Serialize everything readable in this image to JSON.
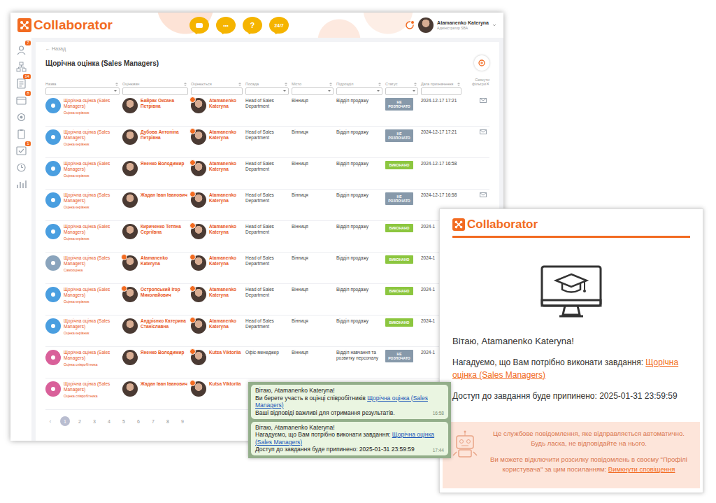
{
  "app": {
    "logo": "Collaborator",
    "header": {
      "bubbles": [
        "•••",
        "?",
        "24/7"
      ],
      "user": {
        "name": "Atamanenko Kateryna",
        "role": "Адміністратор SBA"
      }
    },
    "sidebar": {
      "items": [
        {
          "badge": "7"
        },
        {
          "badge": null
        },
        {
          "badge": "14"
        },
        {
          "badge": "8"
        },
        {
          "badge": null
        },
        {
          "badge": null
        },
        {
          "badge": "1"
        },
        {
          "badge": null
        },
        {
          "badge": null
        }
      ]
    },
    "back": "← Назад",
    "title": "Щорічна оцінка (Sales Managers)",
    "table": {
      "columns": [
        {
          "label": "Назва",
          "filter": "select"
        },
        {
          "label": "Оцінювач",
          "filter": "input"
        },
        {
          "label": "Оцінюється",
          "filter": "input"
        },
        {
          "label": "Посада",
          "filter": "select"
        },
        {
          "label": "Місто",
          "filter": "select"
        },
        {
          "label": "Підрозділ",
          "filter": "select"
        },
        {
          "label": "Статус",
          "filter": "select"
        },
        {
          "label": "Дата призначення",
          "filter": "input"
        }
      ],
      "reset": "Скинути фільтри",
      "reset_icon": "✕",
      "rows": [
        {
          "name": "Щорічна оцінка (Sales Managers)",
          "subtitle": "Оцінка керівник",
          "icon_color": "#4a9fe0",
          "evaluator": "Байрак Оксана Петрівна",
          "evaluator_marked": false,
          "evaluated": "Atamanenko Kateryna",
          "position": "Head of Sales Department",
          "city": "Вінниця",
          "department": "Відділ продажу",
          "status": {
            "label": "НЕ РОЗПОЧАТО",
            "color": "#8799aa"
          },
          "date": "2024-12-17 17:21",
          "reminder": true
        },
        {
          "name": "Щорічна оцінка (Sales Managers)",
          "subtitle": "Оцінка керівник",
          "icon_color": "#4a9fe0",
          "evaluator": "Дубова Антоніна Петрівна",
          "evaluator_marked": false,
          "evaluated": "Atamanenko Kateryna",
          "position": "Head of Sales Department",
          "city": "Вінниця",
          "department": "Відділ продажу",
          "status": {
            "label": "НЕ РОЗПОЧАТО",
            "color": "#8799aa"
          },
          "date": "2024-12-17 17:21",
          "reminder": true
        },
        {
          "name": "Щорічна оцінка (Sales Managers)",
          "subtitle": "Оцінка керівник",
          "icon_color": "#4a9fe0",
          "evaluator": "Яненко Володимир",
          "evaluator_marked": false,
          "evaluated": "Atamanenko Kateryna",
          "position": "Head of Sales Department",
          "city": "Вінниця",
          "department": "Відділ продажу",
          "status": {
            "label": "ВИКОНАНО",
            "color": "#8cc63f"
          },
          "date": "2024-12-17 16:58",
          "reminder": false
        },
        {
          "name": "Щорічна оцінка (Sales Managers)",
          "subtitle": "Оцінка керівник",
          "icon_color": "#4a9fe0",
          "evaluator": "Жадан Іван Іванович",
          "evaluator_marked": false,
          "evaluated": "Atamanenko Kateryna",
          "position": "Head of Sales Department",
          "city": "Вінниця",
          "department": "Відділ продажу",
          "status": {
            "label": "НЕ РОЗПОЧАТО",
            "color": "#8799aa"
          },
          "date": "2024-12-17 16:58",
          "reminder": true
        },
        {
          "name": "Щорічна оцінка (Sales Managers)",
          "subtitle": "Оцінка керівник",
          "icon_color": "#4a9fe0",
          "evaluator": "Кириченко Тетяна Сергіївна",
          "evaluator_marked": false,
          "evaluated": "Atamanenko Kateryna",
          "position": "Head of Sales Department",
          "city": "Вінниця",
          "department": "Відділ продажу",
          "status": {
            "label": "ВИКОНАНО",
            "color": "#8cc63f"
          },
          "date": "2024-1",
          "reminder": false
        },
        {
          "name": "Щорічна оцінка (Sales Managers)",
          "subtitle": "Самооцінка",
          "icon_color": "#8aa4bd",
          "evaluator": "Atamanenko Kateryna",
          "evaluator_marked": true,
          "evaluated": "Atamanenko Kateryna",
          "position": "Head of Sales Department",
          "city": "Вінниця",
          "department": "Відділ продажу",
          "status": {
            "label": "ВИКОНАНО",
            "color": "#8cc63f"
          },
          "date": "2024-1",
          "reminder": false
        },
        {
          "name": "Щорічна оцінка (Sales Managers)",
          "subtitle": "Оцінка керівник",
          "icon_color": "#4a9fe0",
          "evaluator": "Остропський Ігор Миколайович",
          "evaluator_marked": true,
          "evaluated": "Atamanenko Kateryna",
          "position": "Head of Sales Department",
          "city": "Вінниця",
          "department": "Відділ продажу",
          "status": {
            "label": "ВИКОНАНО",
            "color": "#8cc63f"
          },
          "date": "2024-1",
          "reminder": false
        },
        {
          "name": "Щорічна оцінка (Sales Managers)",
          "subtitle": "Оцінка керівник",
          "icon_color": "#4a9fe0",
          "evaluator": "Андрієнко Катерина Станіславна",
          "evaluator_marked": false,
          "evaluated": "Atamanenko Kateryna",
          "position": "Head of Sales Department",
          "city": "Вінниця",
          "department": "Відділ продажу",
          "status": {
            "label": "ВИКОНАНО",
            "color": "#8cc63f"
          },
          "date": "2024-1",
          "reminder": false
        },
        {
          "name": "Щорічна оцінка (Sales Managers)",
          "subtitle": "Оцінка співробітника",
          "icon_color": "#d9609a",
          "evaluator": "Яненко Володимир",
          "evaluator_marked": false,
          "evaluated": "Kutsa Viktoriia",
          "position": "Офіс-менеджер",
          "city": "Вінниця",
          "department": "Відділ навчання та розвитку персоналу",
          "status": {
            "label": "НЕ РОЗПОЧАТО",
            "color": "#8799aa"
          },
          "date": "2024-1",
          "reminder": false
        },
        {
          "name": "Щорічна оцінка (Sales Managers)",
          "subtitle": "Оцінка співробітника",
          "icon_color": "#d9609a",
          "evaluator": "Жадан Іван Іванович",
          "evaluator_marked": false,
          "evaluated": "Kutsa Viktoriia",
          "reminder": false
        }
      ]
    },
    "pagination": {
      "prev": "‹",
      "pages": [
        {
          "label": "1",
          "selected": true
        },
        {
          "label": "2",
          "selected": false
        },
        {
          "label": "3",
          "selected": false
        },
        {
          "label": "4",
          "selected": false
        },
        {
          "label": "5",
          "selected": false
        },
        {
          "label": "6",
          "selected": false
        },
        {
          "label": "7",
          "selected": false
        },
        {
          "label": "8",
          "selected": false
        },
        {
          "label": "9",
          "selected": false
        }
      ]
    }
  },
  "email": {
    "logo": "Collaborator",
    "greeting": "Вітаю, Atamanenko Kateryna!",
    "text": "Нагадуємо, що Вам потрібно виконати завдання: ",
    "link": "Щорічна оцінка (Sales Managers)",
    "access": "Доступ до завдання буде припинено: 2025-01-31 23:59:59",
    "footer": {
      "note": "Це службове повідомлення, яке відправляється автоматично. Будь ласка, не відповідайте на нього.",
      "settings": "Ви можете відключити розсилку повідомлень в своєму \"Профілі користувача\" за цим посиланням: ",
      "link": "Вимкнути сповіщення"
    }
  },
  "chat": {
    "messages": [
      {
        "greeting": "Вітаю, Atamanenko Kateryna!",
        "text": "Ви берете участь в оцінці співробітників ",
        "link": "Щорічна оцінка (Sales Managers)",
        "after": "Ваші відповіді важливі для отримання результатів.",
        "time": "16:58"
      },
      {
        "greeting": "Вітаю, Atamanenko Kateryna!",
        "text": "Нагадуємо, що Вам потрібно виконати завдання: ",
        "link": "Щорічна оцінка (Sales Managers)",
        "after": "Доступ до завдання буде припинено: 2025-01-31 23:59:59",
        "time": "17:44"
      }
    ]
  }
}
